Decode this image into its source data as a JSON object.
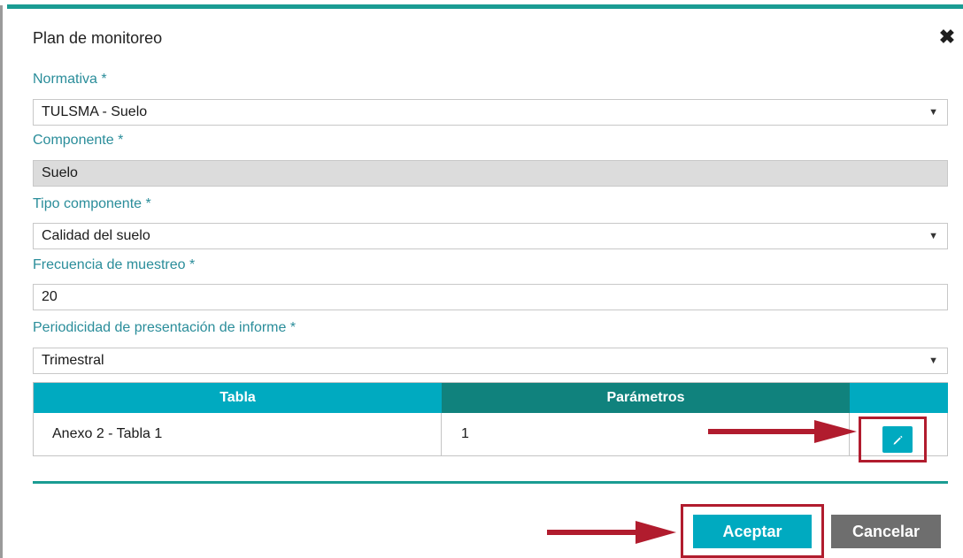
{
  "modal": {
    "title": "Plan de monitoreo",
    "close_icon": "close-icon"
  },
  "fields": {
    "normativa": {
      "label": "Normativa *",
      "value": "TULSMA - Suelo"
    },
    "componente": {
      "label": "Componente *",
      "value": "Suelo"
    },
    "tipo_componente": {
      "label": "Tipo componente *",
      "value": "Calidad del suelo"
    },
    "frecuencia": {
      "label": "Frecuencia de muestreo *",
      "value": "20"
    },
    "periodicidad": {
      "label": "Periodicidad de presentación de informe *",
      "value": "Trimestral"
    }
  },
  "table": {
    "headers": {
      "tabla": "Tabla",
      "parametros": "Parámetros",
      "acciones": ""
    },
    "rows": [
      {
        "tabla": "Anexo 2 - Tabla 1",
        "parametros": "1",
        "edit_icon": "pencil-icon"
      }
    ]
  },
  "actions": {
    "accept": "Aceptar",
    "cancel": "Cancelar"
  },
  "colors": {
    "accent": "#00aac0",
    "teal_dark": "#10827d",
    "label": "#2a8d9a",
    "highlight": "#b11c2e",
    "cancel": "#6e6e6e"
  }
}
